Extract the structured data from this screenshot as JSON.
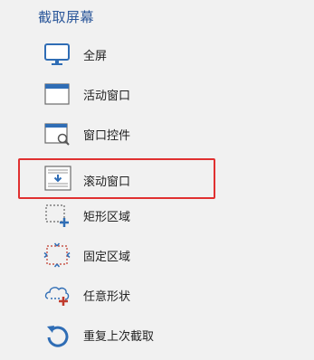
{
  "panel": {
    "title": "截取屏幕",
    "items": [
      {
        "label": "全屏",
        "icon": "monitor-icon"
      },
      {
        "label": "活动窗口",
        "icon": "window-icon"
      },
      {
        "label": "窗口控件",
        "icon": "window-control-icon"
      },
      {
        "label": "滚动窗口",
        "icon": "scroll-window-icon",
        "highlighted": true
      },
      {
        "label": "矩形区域",
        "icon": "rect-region-icon"
      },
      {
        "label": "固定区域",
        "icon": "fixed-region-icon"
      },
      {
        "label": "任意形状",
        "icon": "freeform-shape-icon"
      },
      {
        "label": "重复上次截取",
        "icon": "repeat-capture-icon"
      }
    ]
  },
  "colors": {
    "accent": "#2b579a",
    "highlight_border": "#e03030",
    "background": "#f1f1f1"
  }
}
